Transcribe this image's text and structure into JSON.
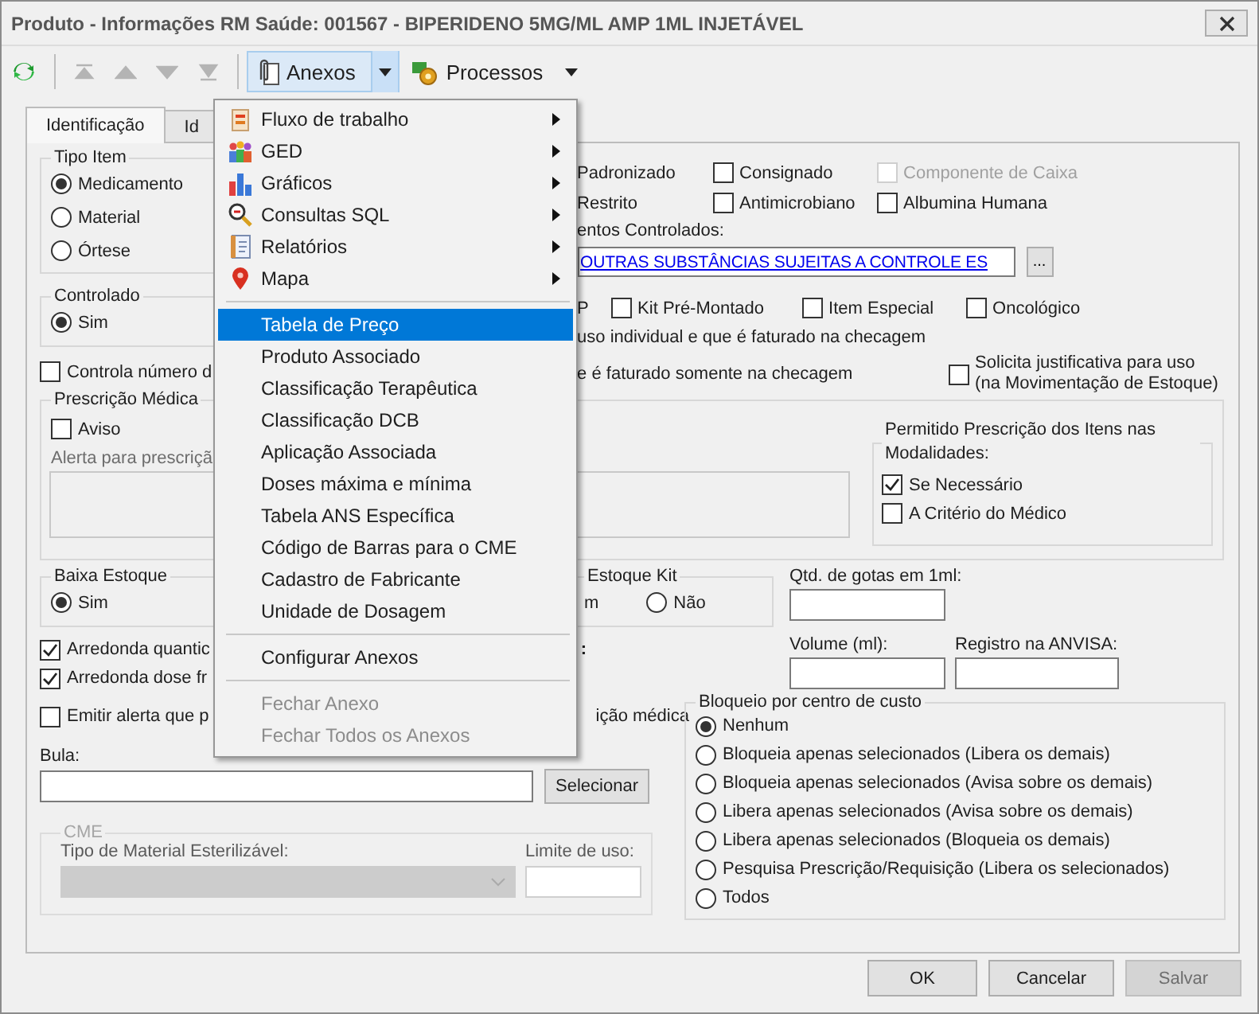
{
  "window": {
    "title": "Produto - Informações RM Saúde: 001567 - BIPERIDENO 5MG/ML AMP 1ML INJETÁVEL"
  },
  "toolbar": {
    "nav_buttons": [
      {
        "kind": "first",
        "disabled": true
      },
      {
        "kind": "prev",
        "disabled": true
      },
      {
        "kind": "next",
        "disabled": true
      },
      {
        "kind": "last",
        "disabled": true
      }
    ],
    "menus": [
      {
        "label": "Anexos",
        "open": true
      },
      {
        "label": "Processos",
        "open": false
      }
    ]
  },
  "tabs": [
    {
      "label": "Identificação",
      "selected": true
    },
    {
      "label": "Id",
      "selected": false
    }
  ],
  "tipo_item": {
    "title": "Tipo Item",
    "options": [
      {
        "label": "Medicamento",
        "selected": true
      },
      {
        "label": "Material",
        "selected": false
      },
      {
        "label": "Órtese",
        "selected": false
      }
    ]
  },
  "controlado": {
    "title": "Controlado",
    "options": [
      {
        "label": "Sim",
        "selected": true
      }
    ]
  },
  "controla": {
    "label": "Controla número d",
    "checked": false
  },
  "classification": {
    "rows": [
      [
        {
          "kind": "text",
          "label": "Padronizado"
        },
        {
          "kind": "checkbox",
          "label": "Consignado",
          "checked": false,
          "disabled": false
        },
        {
          "kind": "checkbox",
          "label": "Componente de Caixa",
          "checked": false,
          "disabled": true
        }
      ],
      [
        {
          "kind": "text",
          "label": "Restrito"
        },
        {
          "kind": "checkbox",
          "label": "Antimicrobiano",
          "checked": false,
          "disabled": false
        },
        {
          "kind": "checkbox",
          "label": "Albumina Humana",
          "checked": false,
          "disabled": false
        }
      ],
      [
        {
          "kind": "text",
          "label": "P"
        },
        {
          "kind": "checkbox",
          "label": "Kit Pré-Montado",
          "checked": false,
          "disabled": false
        },
        {
          "kind": "checkbox",
          "label": "Item Especial",
          "checked": false,
          "disabled": false
        },
        {
          "kind": "checkbox",
          "label": "Oncológico",
          "checked": false,
          "disabled": false
        }
      ]
    ]
  },
  "controlled_group": {
    "label": "entos Controlados:",
    "value": "OUTRAS SUBSTÂNCIAS SUJEITAS A CONTROLE ES",
    "button": "..."
  },
  "billing_notes": [
    "uso individual e que é faturado na checagem",
    "e é faturado somente na checagem"
  ],
  "justification": {
    "lines": [
      "Solicita justificativa para uso",
      "(na Movimentação de Estoque)"
    ],
    "checked": false
  },
  "prescricao": {
    "title": "Prescrição Médica",
    "aviso": {
      "label": "Aviso",
      "checked": false
    },
    "alert_label": "Alerta para prescriçã",
    "modalidades": {
      "title": "Permitido Prescrição dos Itens nas Modalidades:",
      "options": [
        {
          "label": "Se Necessário",
          "checked": true
        },
        {
          "label": "A Critério do Médico",
          "checked": false
        }
      ]
    }
  },
  "baixa_estoque": {
    "title": "Baixa Estoque",
    "options": [
      {
        "label": "Sim",
        "selected": true
      }
    ]
  },
  "estoque_kit": {
    "title": "Estoque Kit",
    "tail": "m",
    "options": [
      {
        "label": "Não",
        "selected": false
      }
    ]
  },
  "rounding": [
    {
      "label": "Arredonda quantic",
      "checked": true
    },
    {
      "label": "Arredonda dose fr",
      "checked": true
    }
  ],
  "colon_fragment": ":",
  "measure_fields": [
    {
      "label": "Qtd. de gotas em 1ml:"
    },
    {
      "label": "Volume (ml):"
    },
    {
      "label": "Registro na ANVISA:"
    }
  ],
  "emitir": {
    "label": "Emitir alerta que p",
    "checked": false,
    "tail": "ição médica"
  },
  "bula": {
    "label": "Bula:",
    "button": "Selecionar"
  },
  "cme": {
    "title": "CME",
    "disabled": true,
    "type_label": "Tipo de Material Esterilizável:",
    "limit_label": "Limite de uso:"
  },
  "bloqueio": {
    "title": "Bloqueio por centro de custo",
    "options": [
      {
        "label": "Nenhum",
        "selected": true
      },
      {
        "label": "Bloqueia apenas selecionados (Libera os demais)",
        "selected": false
      },
      {
        "label": "Bloqueia apenas selecionados (Avisa sobre os demais)",
        "selected": false
      },
      {
        "label": "Libera apenas selecionados (Avisa sobre os demais)",
        "selected": false
      },
      {
        "label": "Libera apenas selecionados (Bloqueia os demais)",
        "selected": false
      },
      {
        "label": "Pesquisa Prescrição/Requisição (Libera os selecionados)",
        "selected": false
      },
      {
        "label": "Todos",
        "selected": false
      }
    ]
  },
  "buttons": [
    {
      "label": "OK",
      "disabled": false
    },
    {
      "label": "Cancelar",
      "disabled": false
    },
    {
      "label": "Salvar",
      "disabled": true
    }
  ],
  "anexos_menu": {
    "items": [
      {
        "kind": "submenu",
        "label": "Fluxo de trabalho",
        "selected": false,
        "disabled": false
      },
      {
        "kind": "submenu",
        "label": "GED",
        "selected": false,
        "disabled": false
      },
      {
        "kind": "submenu",
        "label": "Gráficos",
        "selected": false,
        "disabled": false
      },
      {
        "kind": "submenu",
        "label": "Consultas SQL",
        "selected": false,
        "disabled": false
      },
      {
        "kind": "submenu",
        "label": "Relatórios",
        "selected": false,
        "disabled": false
      },
      {
        "kind": "submenu",
        "label": "Mapa",
        "selected": false,
        "disabled": false
      },
      {
        "kind": "separator"
      },
      {
        "kind": "item",
        "label": "Tabela de Preço",
        "selected": true,
        "disabled": false
      },
      {
        "kind": "item",
        "label": "Produto Associado",
        "selected": false,
        "disabled": false
      },
      {
        "kind": "item",
        "label": "Classificação Terapêutica",
        "selected": false,
        "disabled": false
      },
      {
        "kind": "item",
        "label": "Classificação DCB",
        "selected": false,
        "disabled": false
      },
      {
        "kind": "item",
        "label": "Aplicação Associada",
        "selected": false,
        "disabled": false
      },
      {
        "kind": "item",
        "label": "Doses máxima e mínima",
        "selected": false,
        "disabled": false
      },
      {
        "kind": "item",
        "label": "Tabela ANS Específica",
        "selected": false,
        "disabled": false
      },
      {
        "kind": "item",
        "label": "Código de Barras para o CME",
        "selected": false,
        "disabled": false
      },
      {
        "kind": "item",
        "label": "Cadastro de Fabricante",
        "selected": false,
        "disabled": false
      },
      {
        "kind": "item",
        "label": "Unidade de Dosagem",
        "selected": false,
        "disabled": false
      },
      {
        "kind": "separator"
      },
      {
        "kind": "item",
        "label": "Configurar Anexos",
        "selected": false,
        "disabled": false
      },
      {
        "kind": "separator"
      },
      {
        "kind": "item",
        "label": "Fechar Anexo",
        "selected": false,
        "disabled": true
      },
      {
        "kind": "item",
        "label": "Fechar Todos os Anexos",
        "selected": false,
        "disabled": true
      }
    ]
  }
}
